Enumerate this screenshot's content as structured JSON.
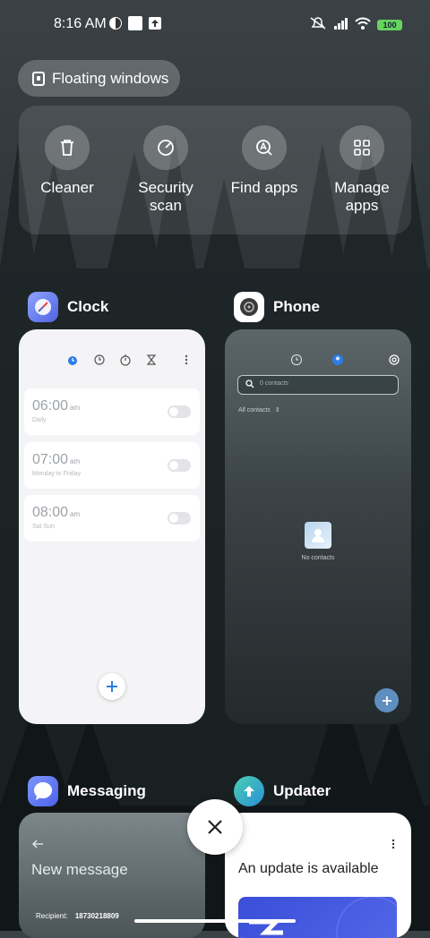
{
  "status_bar": {
    "time": "8:16 AM",
    "battery": "100"
  },
  "floating_windows": {
    "label": "Floating windows"
  },
  "quick_actions": [
    {
      "label": "Cleaner",
      "icon": "trash-icon"
    },
    {
      "label": "Security scan",
      "icon": "security-scan-icon"
    },
    {
      "label": "Find apps",
      "icon": "find-apps-icon"
    },
    {
      "label": "Manage apps",
      "icon": "manage-apps-icon"
    }
  ],
  "apps": {
    "clock": {
      "name": "Clock",
      "alarms": [
        {
          "time": "06:00",
          "ampm": "am",
          "repeat": "Daily"
        },
        {
          "time": "07:00",
          "ampm": "am",
          "repeat": "Monday to Friday"
        },
        {
          "time": "08:00",
          "ampm": "am",
          "repeat": "Sat Sun"
        }
      ]
    },
    "phone": {
      "name": "Phone",
      "search_placeholder": "0 contacts",
      "filter": "All contacts",
      "empty_text": "No contacts"
    },
    "messaging": {
      "name": "Messaging",
      "title": "New message",
      "recipient_label": "Recipient:",
      "recipient": "18730218809"
    },
    "updater": {
      "name": "Updater",
      "title": "An update is available"
    }
  },
  "colors": {
    "accent_blue": "#2b7de9",
    "battery_green": "#67d35f"
  }
}
